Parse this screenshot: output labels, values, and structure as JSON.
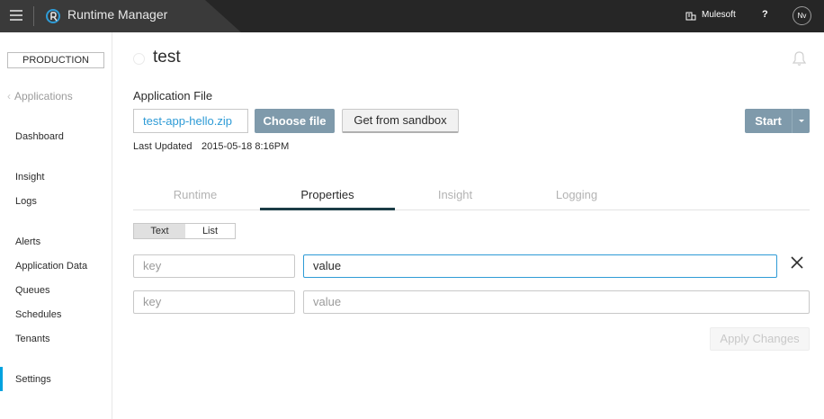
{
  "topbar": {
    "app_title": "Runtime Manager",
    "org_name": "Mulesoft",
    "help_label": "?",
    "user_initials": "Nv"
  },
  "sidebar": {
    "environment": "PRODUCTION",
    "back_label": "Applications",
    "items": [
      {
        "label": "Dashboard"
      },
      {
        "label": "Insight"
      },
      {
        "label": "Logs"
      },
      {
        "label": "Alerts"
      },
      {
        "label": "Application Data"
      },
      {
        "label": "Queues"
      },
      {
        "label": "Schedules"
      },
      {
        "label": "Tenants"
      },
      {
        "label": "Settings"
      }
    ],
    "active_item": "Settings"
  },
  "main": {
    "title": "test",
    "application_file_label": "Application File",
    "file_name": "test-app-hello.zip",
    "choose_file_label": "Choose file",
    "sandbox_label": "Get from sandbox",
    "start_label": "Start",
    "last_updated_label": "Last Updated",
    "last_updated_value": "2015-05-18 8:16PM",
    "tabs": [
      {
        "label": "Runtime"
      },
      {
        "label": "Properties"
      },
      {
        "label": "Insight"
      },
      {
        "label": "Logging"
      }
    ],
    "active_tab": "Properties",
    "toggle": {
      "text_label": "Text",
      "list_label": "List",
      "selected": "Text"
    },
    "properties": [
      {
        "key_placeholder": "key",
        "value_placeholder": "value"
      },
      {
        "key_placeholder": "key",
        "value_placeholder": "value"
      }
    ],
    "apply_label": "Apply Changes"
  },
  "colors": {
    "topbar": "#262626",
    "accent_blue": "#2e9bd6",
    "button_slate": "#7f9aab",
    "active_tab_underline": "#1b3c46",
    "sidebar_active": "#00a2df"
  },
  "icons": [
    "menu-icon",
    "runtime-manager-logo-icon",
    "org-icon",
    "notification-bell-icon",
    "remove-icon",
    "chevron-left-icon",
    "caret-down-icon",
    "status-icon"
  ]
}
